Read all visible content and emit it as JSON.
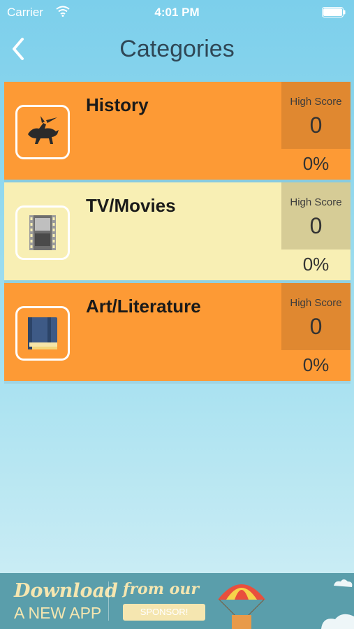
{
  "status_bar": {
    "carrier": "Carrier",
    "time": "4:01 PM"
  },
  "nav": {
    "title": "Categories",
    "back_icon": "chevron-left-icon"
  },
  "categories": [
    {
      "name": "History",
      "icon": "horse-knight-icon",
      "high_score_label": "High Score",
      "high_score": "0",
      "percent": "0%"
    },
    {
      "name": "TV/Movies",
      "icon": "film-strip-icon",
      "high_score_label": "High Score",
      "high_score": "0",
      "percent": "0%"
    },
    {
      "name": "Art/Literature",
      "icon": "book-icon",
      "high_score_label": "High Score",
      "high_score": "0",
      "percent": "0%"
    }
  ],
  "ad": {
    "line1": "Download",
    "line2": "A NEW APP",
    "from": "from our",
    "sponsor": "SPONSOR!"
  },
  "colors": {
    "orange": "#fd9a35",
    "cream": "#f8efb4",
    "title": "#2f4756"
  }
}
